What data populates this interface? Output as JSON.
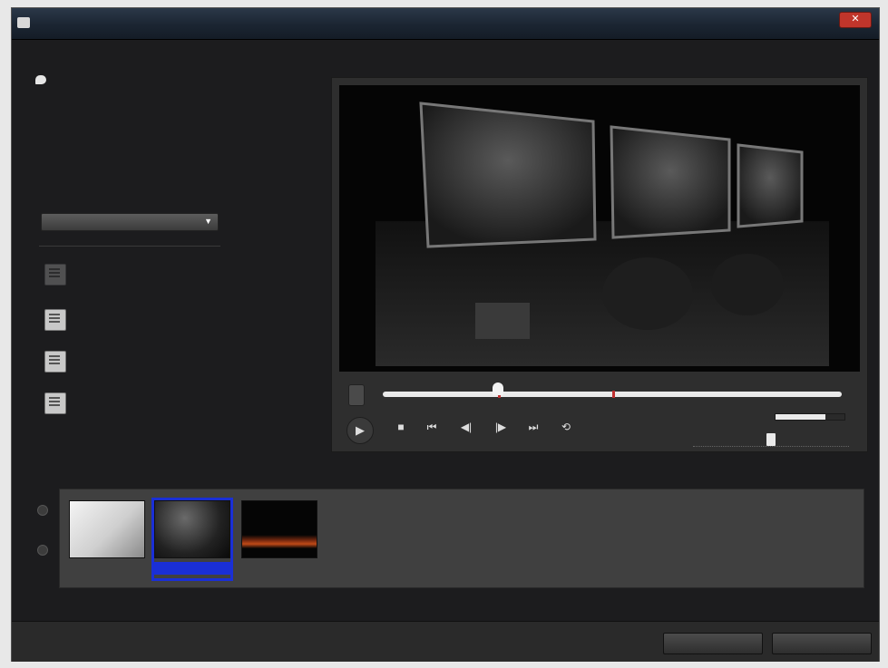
{
  "window": {
    "title": "",
    "close_label": "✕"
  },
  "sidebar": {
    "hint_text": "",
    "section_label": "",
    "dropdown_value": "",
    "actions": [
      {
        "label": "",
        "icon": "scene-detect-icon",
        "enabled": false
      },
      {
        "label": "",
        "icon": "merge-scenes-icon",
        "enabled": true
      },
      {
        "label": "",
        "icon": "delete-scene-icon",
        "enabled": true
      },
      {
        "label": "",
        "icon": "delete-all-scenes-icon",
        "enabled": true
      }
    ],
    "scenes_label": "",
    "scenes_count": ""
  },
  "preview": {
    "playhead_fraction": 0.25,
    "scene_marks": [
      0.25,
      0.5
    ],
    "controls": [
      {
        "name": "stop-icon",
        "glyph": "■"
      },
      {
        "name": "prev-scene-icon",
        "glyph": "⏮"
      },
      {
        "name": "step-back-icon",
        "glyph": "◀|"
      },
      {
        "name": "step-forward-icon",
        "glyph": "|▶"
      },
      {
        "name": "next-scene-icon",
        "glyph": "⏭"
      },
      {
        "name": "loop-icon",
        "glyph": "⟲"
      }
    ],
    "play_glyph": "▶",
    "volume_label": "",
    "volume_level": 0.72,
    "zoom_level": 0.5
  },
  "scenes": [
    {
      "caption": "",
      "selected": false
    },
    {
      "caption": "",
      "selected": true
    },
    {
      "caption": "",
      "selected": false
    }
  ],
  "footer": {
    "ok_label": "",
    "cancel_label": ""
  },
  "colors": {
    "selection": "#1a2fd6",
    "scene_mark": "#c03030",
    "window_bg": "#1c1c1e"
  }
}
